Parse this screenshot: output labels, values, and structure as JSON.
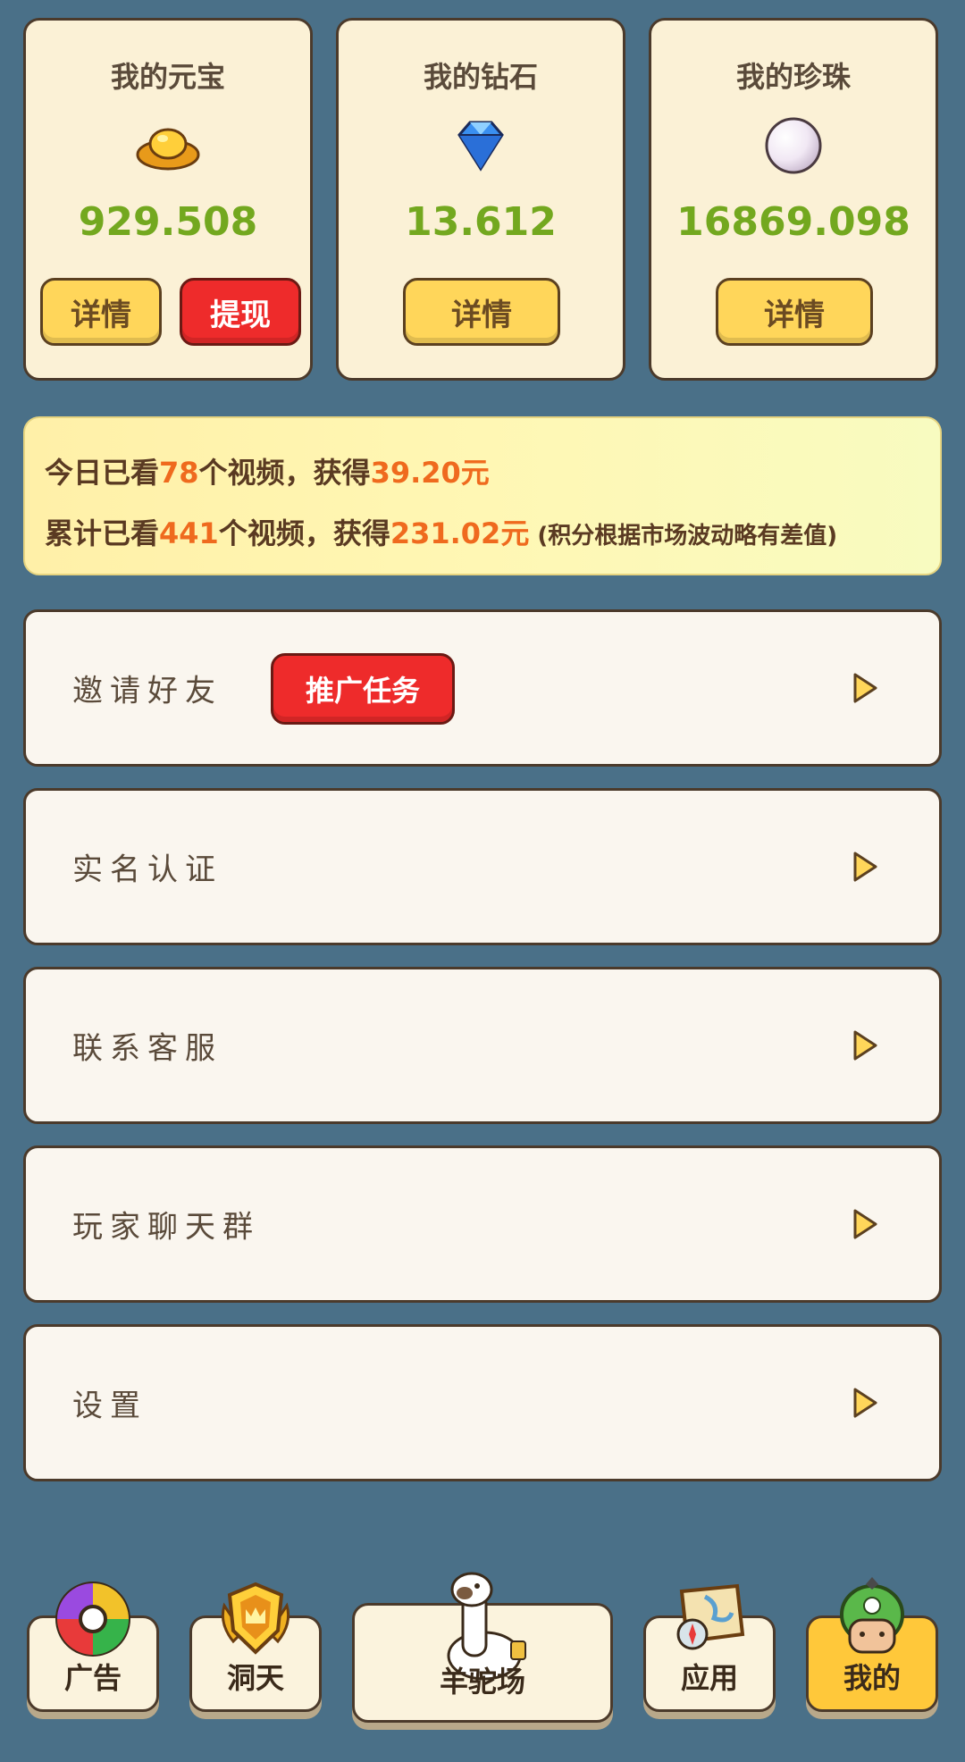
{
  "cards": [
    {
      "title": "我的元宝",
      "value": "929.508",
      "buttons": [
        "详情",
        "提现"
      ],
      "icon": "gold-ingot-icon"
    },
    {
      "title": "我的钻石",
      "value": "13.612",
      "buttons": [
        "详情"
      ],
      "icon": "diamond-icon"
    },
    {
      "title": "我的珍珠",
      "value": "16869.098",
      "buttons": [
        "详情"
      ],
      "icon": "pearl-icon"
    }
  ],
  "banner": {
    "line1": {
      "prefix": "今日已看",
      "count": "78",
      "mid": "个视频，获得",
      "amount": "39.20元"
    },
    "line2": {
      "prefix": "累计已看",
      "count": "441",
      "mid": "个视频，获得",
      "amount": "231.02元",
      "note": " (积分根据市场波动略有差值)"
    }
  },
  "menu": [
    {
      "label": "邀请好友",
      "badge": "推广任务"
    },
    {
      "label": "实名认证"
    },
    {
      "label": "联系客服"
    },
    {
      "label": "玩家聊天群"
    },
    {
      "label": "设置"
    }
  ],
  "nav": [
    {
      "label": "广告",
      "icon": "color-wheel-icon"
    },
    {
      "label": "洞天",
      "icon": "crown-shield-icon"
    },
    {
      "label": "羊驼场",
      "icon": "alpaca-icon"
    },
    {
      "label": "应用",
      "icon": "map-icon"
    },
    {
      "label": "我的",
      "icon": "avatar-icon"
    }
  ],
  "colors": {
    "accent": "#ef6a1e",
    "value_green": "#73a81f",
    "background": "#4a7088",
    "active_tab": "#ffc83a"
  }
}
